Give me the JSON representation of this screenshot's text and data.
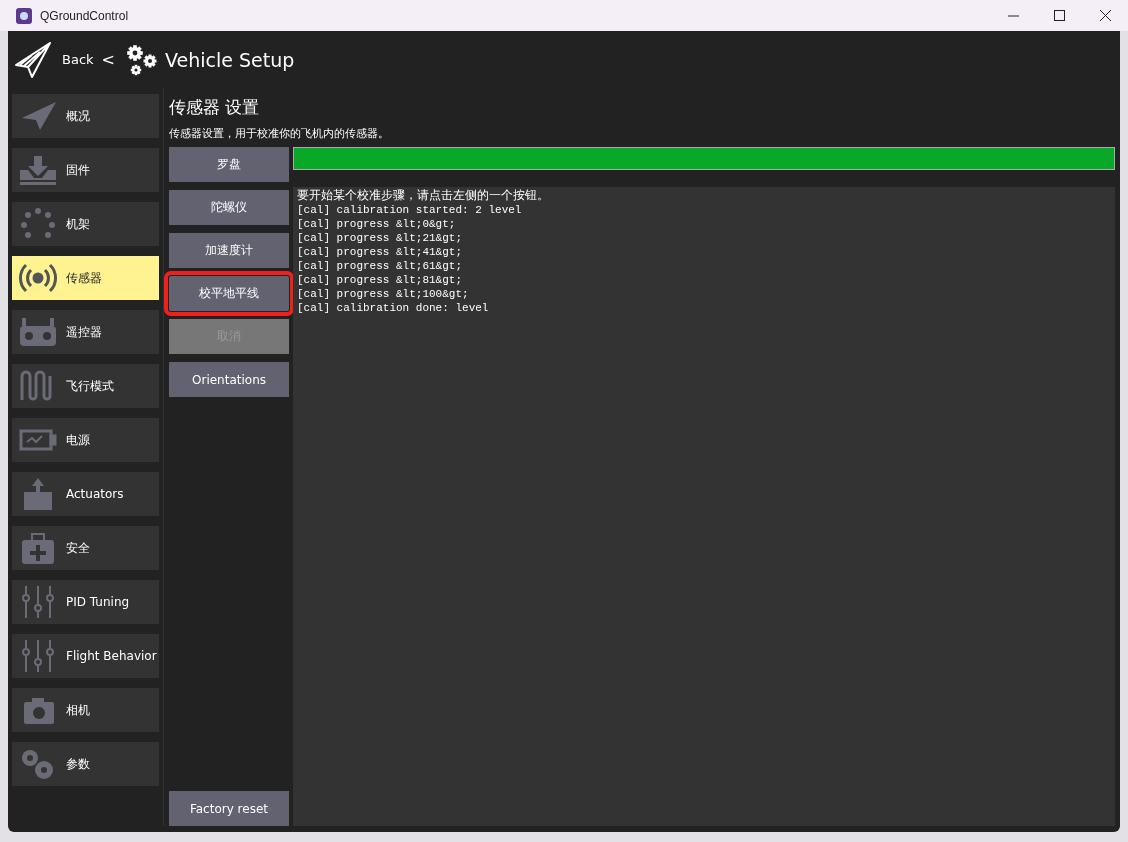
{
  "window": {
    "title": "QGroundControl"
  },
  "header": {
    "back": "Back",
    "separator": "<",
    "title": "Vehicle Setup"
  },
  "sidebar": {
    "items": [
      {
        "label": "概况",
        "selected": false
      },
      {
        "label": "固件",
        "selected": false
      },
      {
        "label": "机架",
        "selected": false
      },
      {
        "label": "传感器",
        "selected": true
      },
      {
        "label": "遥控器",
        "selected": false
      },
      {
        "label": "飞行模式",
        "selected": false
      },
      {
        "label": "电源",
        "selected": false
      },
      {
        "label": "Actuators",
        "selected": false
      },
      {
        "label": "安全",
        "selected": false
      },
      {
        "label": "PID Tuning",
        "selected": false
      },
      {
        "label": "Flight Behavior",
        "selected": false
      },
      {
        "label": "相机",
        "selected": false
      },
      {
        "label": "参数",
        "selected": false
      }
    ]
  },
  "page": {
    "title": "传感器 设置",
    "subtitle": "传感器设置，用于校准你的飞机内的传感器。"
  },
  "sensor_buttons": [
    {
      "label": "罗盘",
      "disabled": false,
      "highlighted": false
    },
    {
      "label": "陀螺仪",
      "disabled": false,
      "highlighted": false
    },
    {
      "label": "加速度计",
      "disabled": false,
      "highlighted": false
    },
    {
      "label": "校平地平线",
      "disabled": false,
      "highlighted": true
    },
    {
      "label": "取消",
      "disabled": true,
      "highlighted": false
    },
    {
      "label": "Orientations",
      "disabled": false,
      "highlighted": false
    }
  ],
  "factory_reset": {
    "label": "Factory reset"
  },
  "progress": {
    "level": 1
  },
  "console": {
    "lines": [
      "要开始某个校准步骤，请点击左侧的一个按钮。",
      "[cal] calibration started: 2 level",
      "[cal] progress &lt;0&gt;",
      "[cal] progress &lt;21&gt;",
      "[cal] progress &lt;41&gt;",
      "[cal] progress &lt;61&gt;",
      "[cal] progress &lt;81&gt;",
      "[cal] progress &lt;100&gt;",
      "[cal] calibration done: level"
    ]
  }
}
